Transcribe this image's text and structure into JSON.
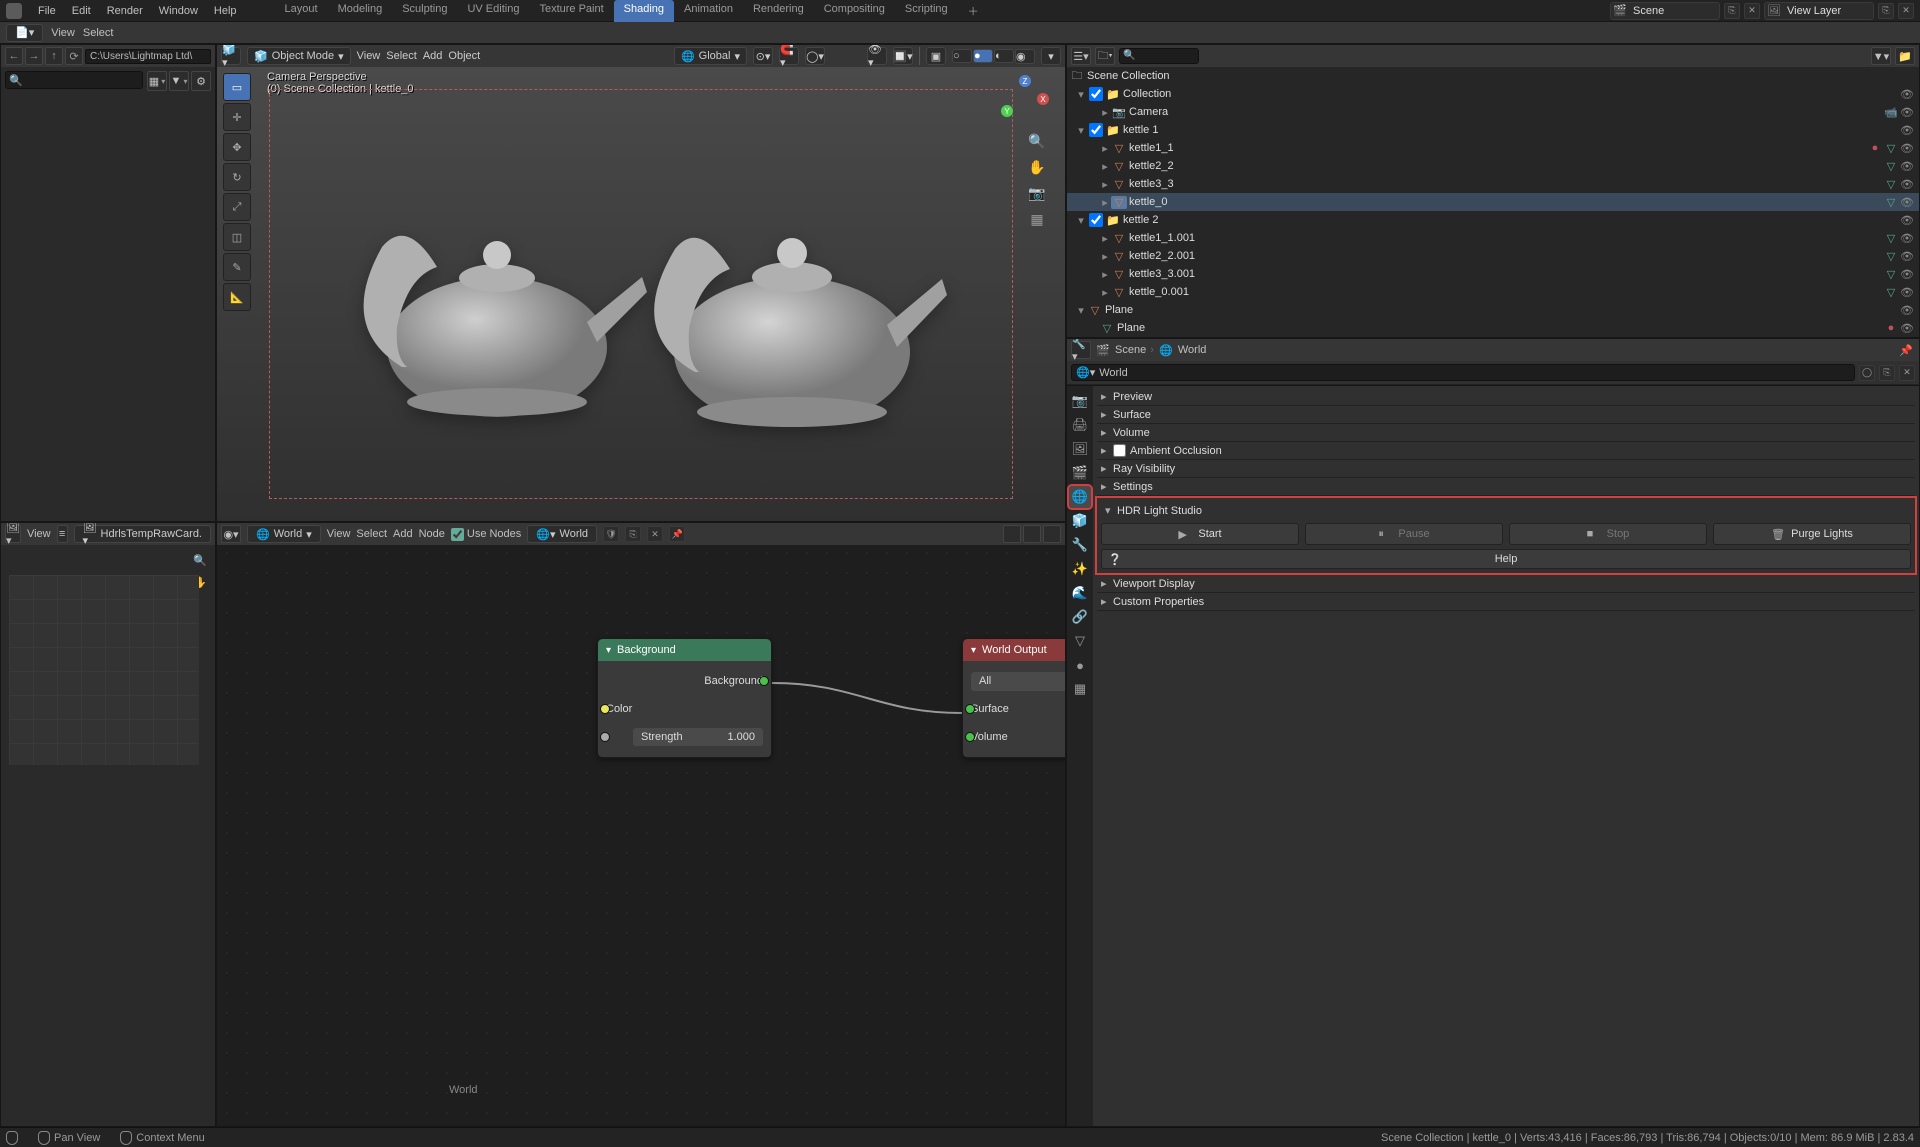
{
  "menu": {
    "items": [
      "File",
      "Edit",
      "Render",
      "Window",
      "Help"
    ]
  },
  "workspaces": {
    "items": [
      "Layout",
      "Modeling",
      "Sculpting",
      "UV Editing",
      "Texture Paint",
      "Shading",
      "Animation",
      "Rendering",
      "Compositing",
      "Scripting"
    ],
    "active": "Shading"
  },
  "scene": {
    "label": "Scene"
  },
  "view_layer": {
    "label": "View Layer"
  },
  "toolbar2": {
    "file": "File",
    "view": "View",
    "select": "Select"
  },
  "filebrowser": {
    "path": "C:\\Users\\Lightmap Ltd\\",
    "search_placeholder": ""
  },
  "viewport": {
    "mode": "Object Mode",
    "menus": [
      "View",
      "Select",
      "Add",
      "Object"
    ],
    "orient": "Global",
    "overlay_line1": "Camera Perspective",
    "overlay_line2": "(0) Scene Collection | kettle_0"
  },
  "outliner": {
    "search_placeholder": "",
    "root": "Scene Collection",
    "tree": [
      {
        "name": "Collection",
        "type": "collection",
        "children": [
          {
            "name": "Camera",
            "type": "camera"
          }
        ]
      },
      {
        "name": "kettle 1",
        "type": "collection",
        "children": [
          {
            "name": "kettle1_1",
            "type": "mesh",
            "mat": true
          },
          {
            "name": "kettle2_2",
            "type": "mesh"
          },
          {
            "name": "kettle3_3",
            "type": "mesh"
          },
          {
            "name": "kettle_0",
            "type": "mesh",
            "sel": true
          }
        ]
      },
      {
        "name": "kettle 2",
        "type": "collection",
        "children": [
          {
            "name": "kettle1_1.001",
            "type": "mesh"
          },
          {
            "name": "kettle2_2.001",
            "type": "mesh"
          },
          {
            "name": "kettle3_3.001",
            "type": "mesh"
          },
          {
            "name": "kettle_0.001",
            "type": "mesh"
          }
        ]
      },
      {
        "name": "Plane",
        "type": "mesh-parent",
        "children": [
          {
            "name": "Plane",
            "type": "mesh",
            "mat": true
          }
        ]
      }
    ]
  },
  "props_header": {
    "scene": "Scene",
    "world": "World"
  },
  "props_crumb": {
    "world": "World"
  },
  "world_sections": {
    "preview": "Preview",
    "surface": "Surface",
    "volume": "Volume",
    "ao": "Ambient Occlusion",
    "ray": "Ray Visibility",
    "settings": "Settings",
    "hdls": "HDR Light Studio",
    "viewport": "Viewport Display",
    "custom": "Custom Properties"
  },
  "hdls": {
    "start": "Start",
    "pause": "Pause",
    "stop": "Stop",
    "purge": "Purge Lights",
    "help": "Help"
  },
  "image_editor": {
    "menus": [
      "View"
    ],
    "image": "HdrlsTempRawCard."
  },
  "node_editor": {
    "menus": [
      "View",
      "Select",
      "Add",
      "Node"
    ],
    "use_nodes": "Use Nodes",
    "type": "World",
    "world_sel": "World",
    "corner_label": "World"
  },
  "nodes": {
    "background": {
      "title": "Background",
      "outputs": {
        "background": "Background"
      },
      "inputs": {
        "color": "Color"
      },
      "strength_label": "Strength",
      "strength_value": "1.000"
    },
    "world_output": {
      "title": "World Output",
      "target": "All",
      "inputs": {
        "surface": "Surface",
        "volume": "Volume"
      }
    }
  },
  "status": {
    "pan": "Pan View",
    "context": "Context Menu",
    "stats": "Scene Collection | kettle_0 | Verts:43,416 | Faces:86,793 | Tris:86,794 | Objects:0/10 | Mem: 86.9 MiB | 2.83.4"
  }
}
